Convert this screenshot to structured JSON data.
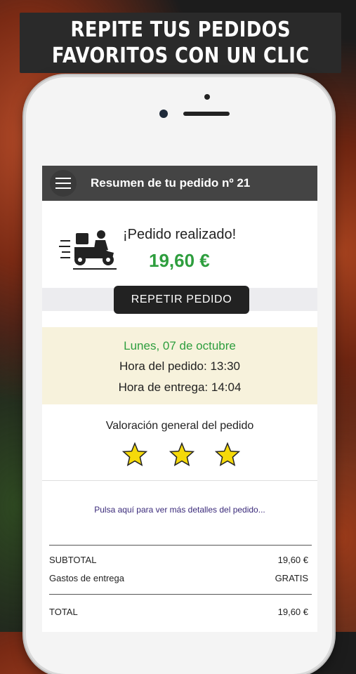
{
  "banner": {
    "line1": "REPITE TUS PEDIDOS",
    "line2": "FAVORITOS CON UN CLIC"
  },
  "appbar": {
    "title": "Resumen de tu pedido nº 21"
  },
  "order": {
    "status": "¡Pedido realizado!",
    "price": "19,60 €",
    "repeat_label": "REPETIR PEDIDO",
    "date": "Lunes, 07 de octubre",
    "order_time": "Hora del pedido: 13:30",
    "delivery_time": "Hora de entrega: 14:04"
  },
  "rating": {
    "label": "Valoración general del pedido",
    "stars": 3
  },
  "details_link": "Pulsa aquí para ver más detalles del pedido...",
  "totals": {
    "subtotal_label": "SUBTOTAL",
    "subtotal_value": "19,60 €",
    "delivery_label": "Gastos de entrega",
    "delivery_value": "GRATIS",
    "total_label": "TOTAL",
    "total_value": "19,60 €"
  },
  "colors": {
    "accent_green": "#2e9e3e",
    "star_yellow": "#f5d90a",
    "header_bg": "#444444"
  }
}
